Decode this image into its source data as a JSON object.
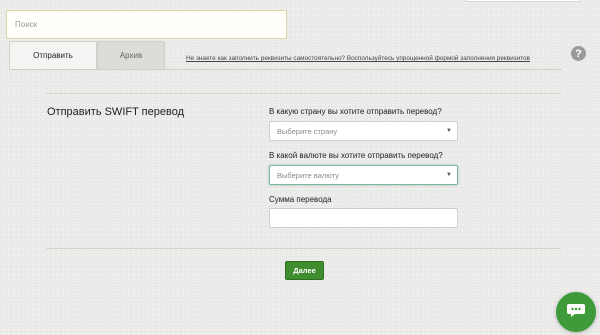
{
  "search": {
    "placeholder": "Поиск"
  },
  "tabs": [
    {
      "label": "Отправить",
      "active": true
    },
    {
      "label": "Архив",
      "active": false
    }
  ],
  "help": {
    "link_text": "Не знаете как заполнить реквизиты самостоятельно? Воспользуйтесь упрощенной формой заполнения реквизитов",
    "icon_glyph": "?"
  },
  "form": {
    "title": "Отправить SWIFT перевод",
    "country": {
      "label": "В какую страну вы хотите отправить перевод?",
      "placeholder": "Выберите страну"
    },
    "currency": {
      "label": "В какой валюте вы хотите отправить перевод?",
      "placeholder": "Выберите валюту"
    },
    "amount": {
      "label": "Сумма перевода",
      "value": ""
    },
    "caret_glyph": "▼",
    "submit_label": "Далее"
  },
  "colors": {
    "accent_green": "#3f8d2f",
    "chat_green": "#3f9a3a",
    "focus_border": "#7fb8a0"
  },
  "icons": [
    "help-icon",
    "chevron-down-icon",
    "chat-icon"
  ]
}
